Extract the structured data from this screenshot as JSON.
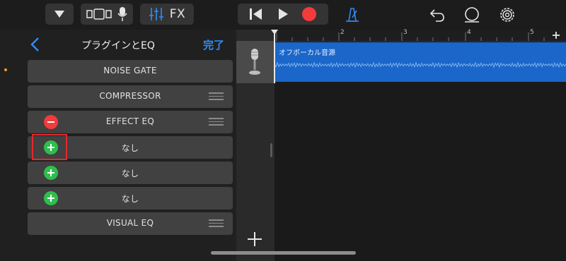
{
  "colors": {
    "accent": "#2f8cf6",
    "record": "#f23b3b",
    "add": "#2fbe4d",
    "region": "#1b66c9",
    "highlight": "#e6282c"
  },
  "toolbar": {
    "fx_label": "FX",
    "icons": [
      "menu-dropdown-icon",
      "track-view-icon",
      "microphone-icon",
      "mixer-icon",
      "go-to-beginning-icon",
      "play-icon",
      "record-icon",
      "metronome-icon",
      "undo-icon",
      "loop-icon",
      "settings-icon"
    ]
  },
  "panel": {
    "title": "プラグインとEQ",
    "done_label": "完了",
    "slots": [
      {
        "label": "NOISE GATE",
        "control": "none",
        "handle": false
      },
      {
        "label": "COMPRESSOR",
        "control": "none",
        "handle": true
      },
      {
        "label": "EFFECT EQ",
        "control": "remove",
        "handle": true
      },
      {
        "label": "なし",
        "control": "add",
        "handle": false
      },
      {
        "label": "なし",
        "control": "add",
        "handle": false
      },
      {
        "label": "なし",
        "control": "add",
        "handle": false
      },
      {
        "label": "VISUAL EQ",
        "control": "none",
        "handle": true
      }
    ]
  },
  "timeline": {
    "bars": [
      "2",
      "3",
      "4",
      "5"
    ],
    "region_name": "オフボーカル音源"
  }
}
